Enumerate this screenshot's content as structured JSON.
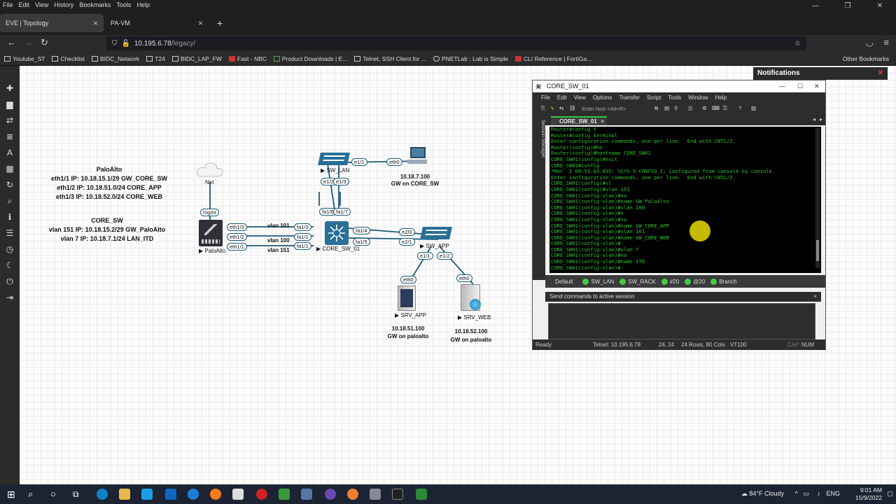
{
  "browser": {
    "menu": [
      "File",
      "Edit",
      "View",
      "History",
      "Bookmarks",
      "Tools",
      "Help"
    ],
    "tabs": [
      {
        "label": "EVE | Topology",
        "active": true
      },
      {
        "label": "PA-VM",
        "active": false
      }
    ],
    "url_host": "10.195.6.78",
    "url_path": "/legacy/",
    "bookmarks": [
      "Youtube_ST",
      "Checklist",
      "BIDC_Network",
      "T24",
      "BIDC_LAP_FW",
      "Fast - NBC",
      "Product Downloads | E...",
      "Telnet, SSH Client for ...",
      "PNETLab : Lab is Simple",
      "CLI Reference | FortiGa..."
    ],
    "other_bookmarks": "Other Bookmarks"
  },
  "notifications": {
    "title": "Notifications"
  },
  "topology": {
    "paloalto_text": [
      "PaloAlto",
      "eth1/1 IP: 10.18.15.1/29 GW_CORE_SW",
      "eth1/2 IP: 10.18.51.0/24 CORE_APP",
      "eth1/3 IP: 10.18.52.0/24 CORE_WEB"
    ],
    "coresw_text": [
      "CORE_SW",
      "vlan 151 IP: 10.18.15.2/29  GW_PaloAlto",
      "vlan 7 IP: 10.18.7.1/24 LAN_ITD"
    ],
    "nodes": {
      "net": "Net",
      "paloalto": "PaloAlto",
      "core": "CORE_SW_01",
      "sw_lan": "SW_LAN",
      "sw_app": "SW_APP",
      "pc": "PC",
      "srv_app": "SRV_APP",
      "srv_web": "SRV_WEB"
    },
    "interfaces": {
      "mgmt": "mgmt",
      "pa_e13": "eth1/3",
      "pa_e12": "eth1/2",
      "pa_e11": "eth1/1",
      "c_fa13": "fa1/3",
      "c_fa12": "fa1/2",
      "c_fa11": "fa1/1",
      "c_fa16": "fa1/6",
      "c_fa17": "fa1/7",
      "c_fa14": "fa1/4",
      "c_fa15": "fa1/5",
      "lan_e11": "e1/1",
      "lan_e12": "e1/2",
      "lan_e13": "e1/3",
      "pc_eth0": "eth0",
      "app_e20": "e2/0",
      "app_e21": "e2/1",
      "app_e11": "e1/1",
      "app_e12": "e1/2",
      "srvapp_eth0": "eth0",
      "srvweb_eth0": "eth0"
    },
    "links": {
      "vlan101": "vlan 101",
      "vlan100": "vlan 100",
      "vlan151": "vlan 151"
    },
    "pc_info": [
      "10.18.7.100",
      "GW on CORE_SW"
    ],
    "srvapp_info": [
      "10.18.51.100",
      "GW on paloalto"
    ],
    "srvweb_info": [
      "10.18.52.100",
      "GW on paloalto"
    ]
  },
  "crt": {
    "title": "CORE_SW_01",
    "menu": [
      "File",
      "Edit",
      "View",
      "Options",
      "Transfer",
      "Script",
      "Tools",
      "Window",
      "Help"
    ],
    "host_placeholder": "Enter host <Alt+R>",
    "tab": "CORE_SW_01",
    "session_manager": "Session Manager",
    "terminal_lines": [
      "Router#config t",
      "Router#config terminal",
      "Enter configuration commands, one per line.  End with CNTL/Z.",
      "Router(config)#ho",
      "Router(config)#hostname CORE_SW01",
      "CORE_SW01(config)#exit",
      "CORE_SW01#config",
      "*Mar  1 00:53:03.835: %SYS-5-CONFIG_I: Configured from console by console",
      "Enter configuration commands, one per line.  End with CNTL/Z.",
      "CORE_SW01(config)#vl",
      "CORE_SW01(config)#vlan 151",
      "CORE_SW01(config-vlan)#na",
      "CORE_SW01(config-vlan)#name GW_PaloAlto",
      "CORE_SW01(config-vlan)#vlan 100",
      "CORE_SW01(config-vlan)#n",
      "CORE_SW01(config-vlan)#na",
      "CORE_SW01(config-vlan)#name GW_CORE_APP",
      "CORE_SW01(config-vlan)#vlan 101",
      "CORE_SW01(config-vlan)#name GW_CORE_WEB",
      "CORE_SW01(config-vlan)#",
      "CORE_SW01(config-vlan)#vlan 7",
      "CORE_SW01(config-vlan)#na",
      "CORE_SW01(config-vlan)#name ITD",
      "CORE_SW01(config-vlan)#"
    ],
    "button_bar": {
      "default": "Default",
      "buttons": [
        "SW_LAN",
        "SW_RACK",
        "#20",
        "@20",
        "Branch"
      ]
    },
    "send_bar": "Send commands to active session",
    "status": {
      "ready": "Ready",
      "telnet": "Telnet: 10.195.6.78",
      "pos": "24, 24",
      "size": "24 Rows, 80 Cols",
      "term": "VT100",
      "cap": "CAP",
      "num": "NUM"
    }
  },
  "taskbar": {
    "weather": "84°F  Cloudy",
    "lang": "ENG",
    "time": "9:01 AM",
    "date": "15/9/2022"
  }
}
